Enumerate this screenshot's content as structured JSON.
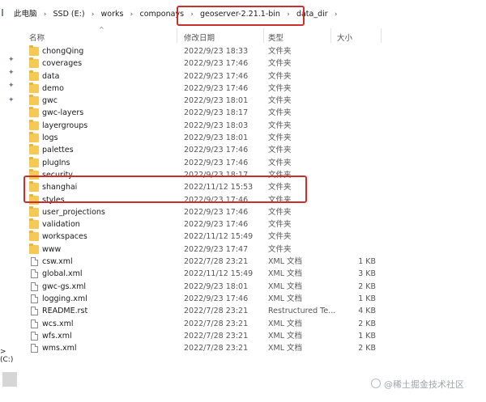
{
  "breadcrumb": {
    "items": [
      "此电脑",
      "SSD (E:)",
      "works",
      "componays",
      "geoserver-2.21.1-bin",
      "data_dir"
    ],
    "separator": "›"
  },
  "columns": {
    "name": "名称",
    "modified": "修改日期",
    "type": "类型",
    "size": "大小"
  },
  "nav": {
    "drive_label": "> (C:)"
  },
  "files": [
    {
      "name": "chongQing",
      "date": "2022/9/23 18:33",
      "type": "文件夹",
      "size": "",
      "kind": "folder"
    },
    {
      "name": "coverages",
      "date": "2022/9/23 17:46",
      "type": "文件夹",
      "size": "",
      "kind": "folder"
    },
    {
      "name": "data",
      "date": "2022/9/23 17:46",
      "type": "文件夹",
      "size": "",
      "kind": "folder"
    },
    {
      "name": "demo",
      "date": "2022/9/23 17:46",
      "type": "文件夹",
      "size": "",
      "kind": "folder"
    },
    {
      "name": "gwc",
      "date": "2022/9/23 18:01",
      "type": "文件夹",
      "size": "",
      "kind": "folder"
    },
    {
      "name": "gwc-layers",
      "date": "2022/9/23 18:17",
      "type": "文件夹",
      "size": "",
      "kind": "folder"
    },
    {
      "name": "layergroups",
      "date": "2022/9/23 18:03",
      "type": "文件夹",
      "size": "",
      "kind": "folder"
    },
    {
      "name": "logs",
      "date": "2022/9/23 18:01",
      "type": "文件夹",
      "size": "",
      "kind": "folder"
    },
    {
      "name": "palettes",
      "date": "2022/9/23 17:46",
      "type": "文件夹",
      "size": "",
      "kind": "folder"
    },
    {
      "name": "plugIns",
      "date": "2022/9/23 17:46",
      "type": "文件夹",
      "size": "",
      "kind": "folder"
    },
    {
      "name": "security",
      "date": "2022/9/23 18:17",
      "type": "文件夹",
      "size": "",
      "kind": "folder"
    },
    {
      "name": "shanghai",
      "date": "2022/11/12 15:53",
      "type": "文件夹",
      "size": "",
      "kind": "folder"
    },
    {
      "name": "styles",
      "date": "2022/9/23 17:46",
      "type": "文件夹",
      "size": "",
      "kind": "folder"
    },
    {
      "name": "user_projections",
      "date": "2022/9/23 17:46",
      "type": "文件夹",
      "size": "",
      "kind": "folder"
    },
    {
      "name": "validation",
      "date": "2022/9/23 17:46",
      "type": "文件夹",
      "size": "",
      "kind": "folder"
    },
    {
      "name": "workspaces",
      "date": "2022/11/12 15:49",
      "type": "文件夹",
      "size": "",
      "kind": "folder"
    },
    {
      "name": "www",
      "date": "2022/9/23 17:47",
      "type": "文件夹",
      "size": "",
      "kind": "folder"
    },
    {
      "name": "csw.xml",
      "date": "2022/7/28 23:21",
      "type": "XML 文档",
      "size": "1 KB",
      "kind": "file"
    },
    {
      "name": "global.xml",
      "date": "2022/11/12 15:49",
      "type": "XML 文档",
      "size": "3 KB",
      "kind": "file"
    },
    {
      "name": "gwc-gs.xml",
      "date": "2022/9/23 18:01",
      "type": "XML 文档",
      "size": "2 KB",
      "kind": "file"
    },
    {
      "name": "logging.xml",
      "date": "2022/9/23 17:46",
      "type": "XML 文档",
      "size": "1 KB",
      "kind": "file"
    },
    {
      "name": "README.rst",
      "date": "2022/7/28 23:21",
      "type": "Restructured Te...",
      "size": "4 KB",
      "kind": "file"
    },
    {
      "name": "wcs.xml",
      "date": "2022/7/28 23:21",
      "type": "XML 文档",
      "size": "2 KB",
      "kind": "file"
    },
    {
      "name": "wfs.xml",
      "date": "2022/7/28 23:21",
      "type": "XML 文档",
      "size": "1 KB",
      "kind": "file"
    },
    {
      "name": "wms.xml",
      "date": "2022/7/28 23:21",
      "type": "XML 文档",
      "size": "2 KB",
      "kind": "file"
    }
  ],
  "watermark": "@稀土掘金技术社区",
  "colors": {
    "highlight": "#c9302c",
    "folder": "#f4c954"
  }
}
